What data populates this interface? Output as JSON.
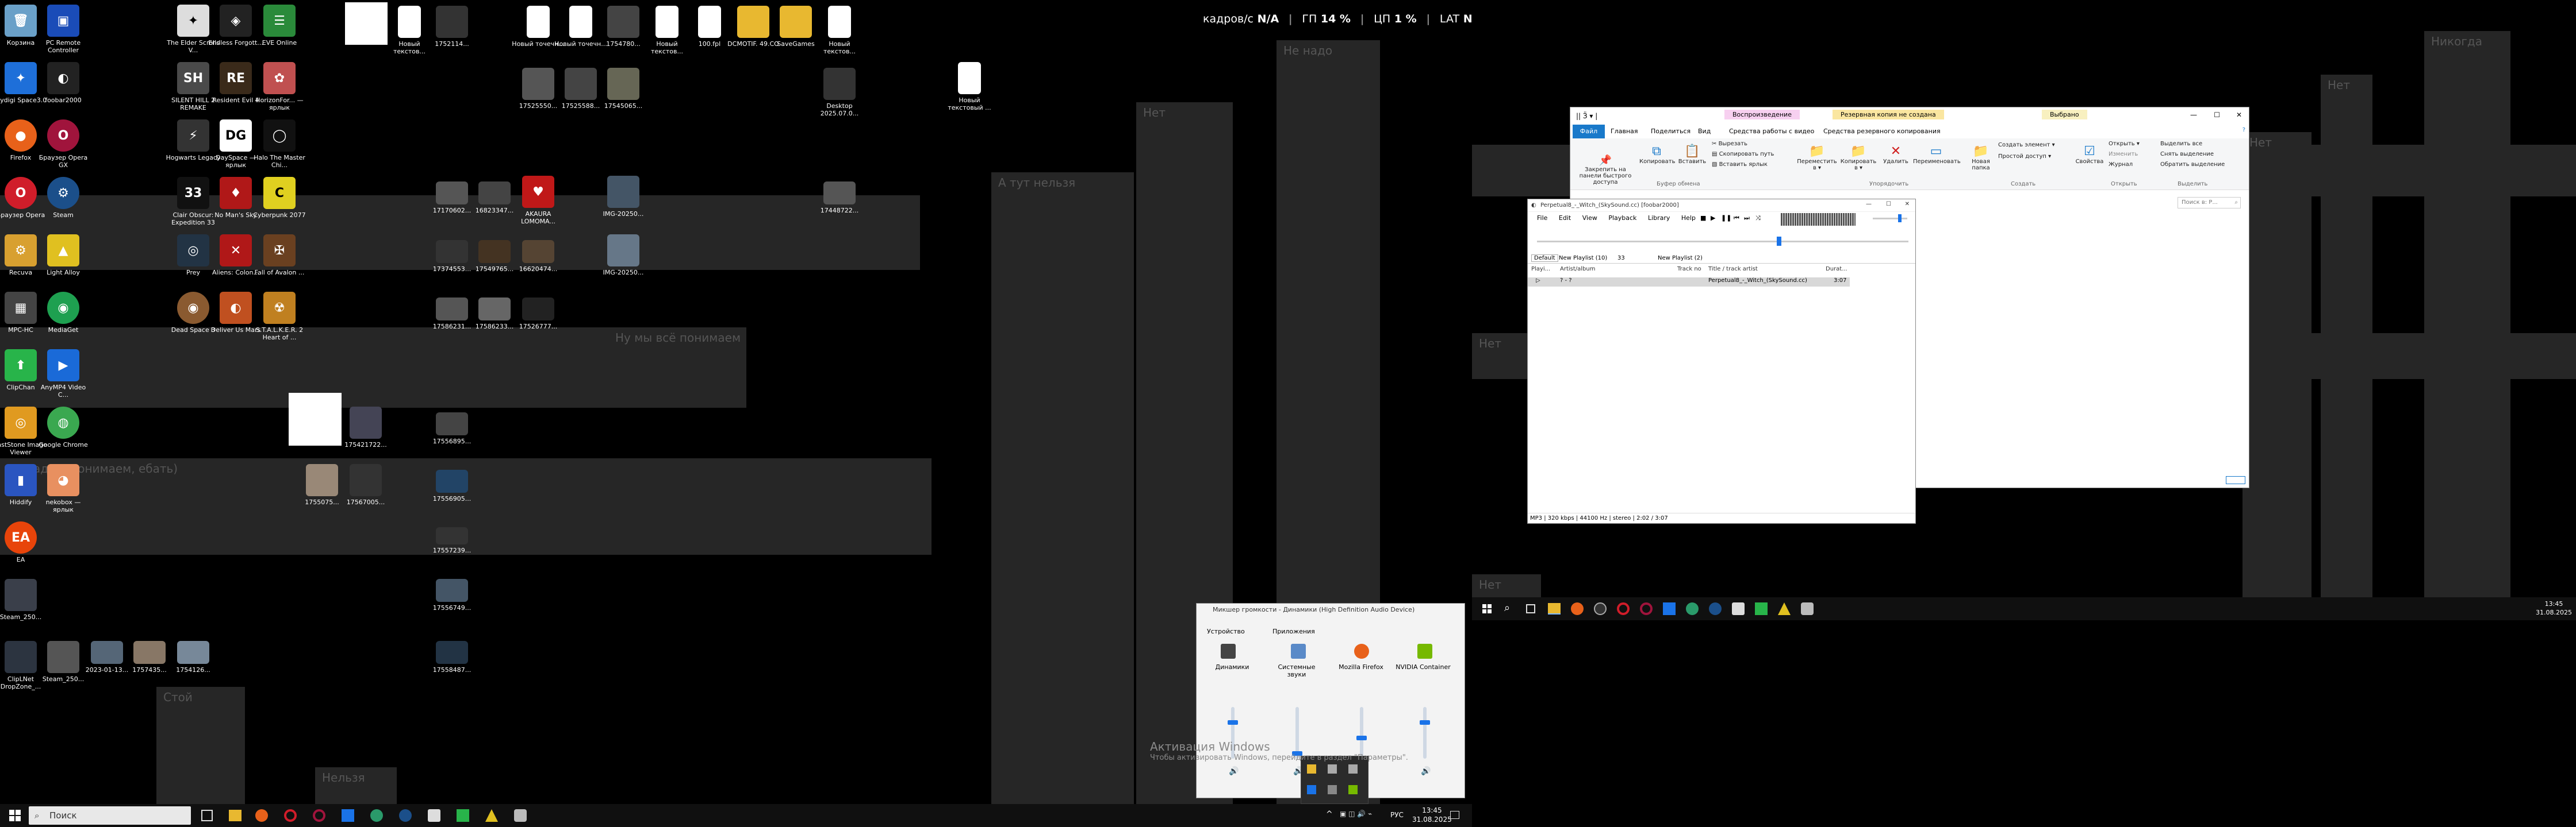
{
  "overlay": {
    "fps_label": "кадров/с",
    "fps": "N/A",
    "gpu_label": "ГП",
    "gpu": "14 %",
    "cpu_label": "ЦП",
    "cpu": "1 %",
    "lat_label": "LAT",
    "lat": "N/A"
  },
  "desktop": {
    "col1": [
      "Корзина",
      "Flydigi Space3.0",
      "Firefox",
      "Браузер Opera",
      "Recuva",
      "MPC-HC",
      "ClipChan",
      "FastStone Image Viewer",
      "Hiddify",
      "EA",
      "Steam_250...",
      "ClipLNet DropZone_..."
    ],
    "col2": [
      "PC Remote Controller",
      "foobar2000",
      "Браузер Opera GX",
      "Steam",
      "Light Alloy",
      "MediaGet",
      "AnyMP4 Video C...",
      "Google Chrome",
      "nekobox — ярлык",
      "",
      "",
      "Steam_250..."
    ],
    "col3": [
      "The Elder Scrolls V...",
      "SILENT HILL 2 REMAKE",
      "Hogwarts Legacy",
      "Clair Obscur: Expedition 33",
      "Prey",
      "Dead Space 3"
    ],
    "col4": [
      "Endless Forgott...",
      "Resident Evil 4",
      "DaySpace — ярлык",
      "No Man's Sky",
      "Aliens: Colon...",
      "Deliver Us Mars"
    ],
    "col5": [
      "EVE Online",
      "HorizonFor... — ярлык",
      "Halo The Master Chi...",
      "Cyberpunk 2077",
      "Fall of Avalon ...",
      "S.T.A.L.K.E.R. 2 Heart of ..."
    ],
    "top_row": [
      "Новый текстов...",
      "1752114...",
      "Новый точечн...",
      "Новый точечн...",
      "1754780...",
      "Новый текстов...",
      "100.fpl",
      "DCMOTIF. 49.CO",
      "SaveGames",
      "Новый текстов..."
    ],
    "row2": [
      "17525550...",
      "17525588...",
      "17545065...",
      "Desktop 2025.07.0..."
    ],
    "far_icon": "Новый текстовый ...",
    "thumbs": [
      "17170602...",
      "16823347...",
      "AKAURA LOMOMA...",
      "IMG-20250...",
      "17448722...",
      "17374553...",
      "17549765...",
      "16620474...",
      "IMG-20250...",
      "17586231...",
      "17586233...",
      "17526777...",
      "175421722...",
      "17556895...",
      "1755075...",
      "17567005...",
      "17556905...",
      "17557239...",
      "17556749...",
      "17558487...",
      "2023-01-13...",
      "1757435...",
      "1754126..."
    ],
    "labels": [
      "Нет",
      "Не надо",
      "А тут нельзя",
      "Ну мы всё понимаем",
      "Ну ладно, понимаем, ебать)",
      "Стой",
      "Нельзя",
      "Нет",
      "Нет",
      "Нет",
      "Нет",
      "Никогда"
    ]
  },
  "explorer": {
    "title": "|| Ӟ ▾ |",
    "tabs": [
      "Файл",
      "Главная",
      "Поделиться",
      "Вид"
    ],
    "ctx_tabs": [
      "Воспроизведение",
      "Резервная копия не создана",
      "Выбрано"
    ],
    "ctx_sub": [
      "Средства работы с видео",
      "Средства резервного копирования"
    ],
    "btn": [
      "Закрепить на панели быстрого доступа",
      "Копировать",
      "Вставить",
      "Вырезать",
      "Скопировать путь",
      "Вставить ярлык",
      "Переместить в ▾",
      "Копировать в ▾",
      "Удалить",
      "Переименовать",
      "Новая папка",
      "Создать элемент ▾",
      "Простой доступ ▾",
      "Свойства",
      "Открыть ▾",
      "Изменить",
      "Журнал",
      "Выделить все",
      "Снять выделение",
      "Обратить выделение"
    ],
    "groups": [
      "Буфер обмена",
      "Упорядочить",
      "Создать",
      "Открыть",
      "Выделить"
    ],
    "search": "Поиск в: Р..."
  },
  "foobar": {
    "title": "Perpetual8_-_Witch_(SkySound.cc)   [foobar2000]",
    "menu": [
      "File",
      "Edit",
      "View",
      "Playback",
      "Library",
      "Help"
    ],
    "tabs": [
      "Default",
      "New Playlist (10)",
      "33",
      "New Playlist (2)"
    ],
    "cols": [
      "Playi...",
      "Artist/album",
      "Track no",
      "Title / track artist",
      "Durat..."
    ],
    "row": {
      "artist": "? - ?",
      "title": "Perpetual8_-_Witch_(SkySound.cc)",
      "dur": "3:07"
    },
    "status": "MP3 | 320 kbps | 44100 Hz | stereo | 2:02 / 3:07"
  },
  "mixer": {
    "title": "Микшер громкости - Динамики (High Definition Audio Device)",
    "dev_label": "Устройство",
    "app_label": "Приложения",
    "channels": [
      "Динамики",
      "Системные звуки",
      "Mozilla Firefox",
      "NVIDIA Container"
    ],
    "levels": [
      0.7,
      0.1,
      0.4,
      0.7
    ]
  },
  "activation": {
    "line1": "Активация Windows",
    "line2": "Чтобы активировать Windows, перейдите в раздел \"Параметры\"."
  },
  "taskbar": {
    "search": "Поиск",
    "lang": "РУС",
    "time": "13:45",
    "date": "31.08.2025"
  },
  "taskbar2": {
    "time": "13:45",
    "date": "31.08.2025"
  },
  "colors": {
    "ribbon_blue": "#1979ca",
    "gray_block": "#262626",
    "slider": "#1a73e8"
  }
}
